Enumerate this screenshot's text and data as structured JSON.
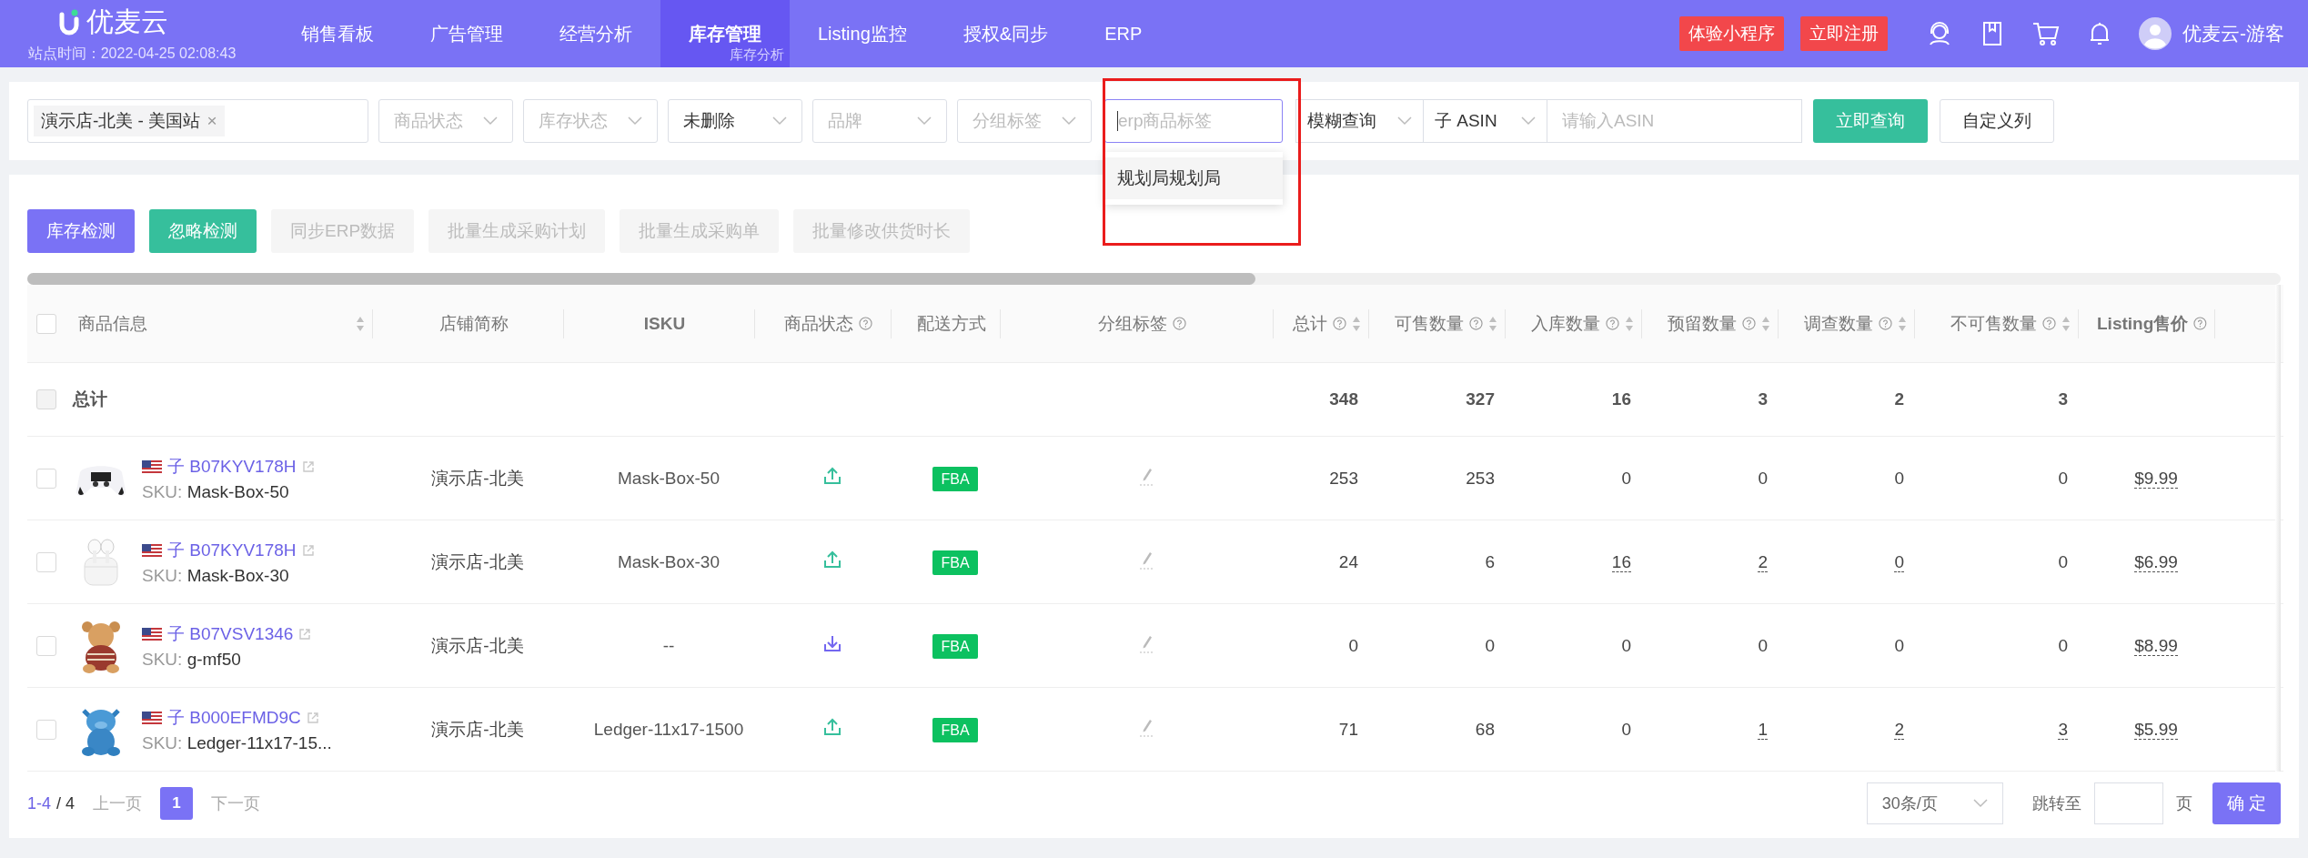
{
  "header": {
    "logo": "优麦云",
    "site_time": "站点时间：2022-04-25 02:08:43",
    "nav": [
      {
        "label": "销售看板",
        "selected": false
      },
      {
        "label": "广告管理",
        "selected": false
      },
      {
        "label": "经营分析",
        "selected": false
      },
      {
        "label": "库存管理",
        "selected": true,
        "sub": "库存分析"
      },
      {
        "label": "Listing监控",
        "selected": false
      },
      {
        "label": "授权&同步",
        "selected": false
      },
      {
        "label": "ERP",
        "selected": false
      }
    ],
    "promos": [
      "体验小程序",
      "立即注册"
    ],
    "user": "优麦云-游客"
  },
  "filters": {
    "store": {
      "tag": "演示店-北美 - 美国站",
      "close": "×"
    },
    "selects": [
      {
        "placeholder": "商品状态"
      },
      {
        "placeholder": "库存状态"
      },
      {
        "value": "未删除"
      },
      {
        "placeholder": "品牌"
      },
      {
        "placeholder": "分组标签"
      }
    ],
    "tag_input": {
      "placeholder": "erp商品标签",
      "focused": true,
      "options": [
        "规划局规划局"
      ]
    },
    "match": {
      "value": "模糊查询"
    },
    "type": {
      "value": "子 ASIN"
    },
    "asin": {
      "placeholder": "请输入ASIN"
    },
    "search_button": "立即查询",
    "columns_button": "自定义列"
  },
  "actions": [
    {
      "label": "库存检测",
      "kind": "primary"
    },
    {
      "label": "忽略检测",
      "kind": "success"
    },
    {
      "label": "同步ERP数据",
      "kind": "disabled"
    },
    {
      "label": "批量生成采购计划",
      "kind": "disabled"
    },
    {
      "label": "批量生成采购单",
      "kind": "disabled"
    },
    {
      "label": "批量修改供货时长",
      "kind": "disabled"
    }
  ],
  "table": {
    "header_checked": false,
    "columns": [
      {
        "label": "商品信息",
        "help": false,
        "sortable": true,
        "bold": false
      },
      {
        "label": "店铺简称",
        "help": false,
        "sortable": false,
        "bold": false
      },
      {
        "label": "ISKU",
        "help": false,
        "sortable": false,
        "bold": true
      },
      {
        "label": "商品状态",
        "help": true,
        "sortable": false,
        "bold": false
      },
      {
        "label": "配送方式",
        "help": false,
        "sortable": false,
        "bold": false
      },
      {
        "label": "分组标签",
        "help": true,
        "sortable": false,
        "bold": false
      },
      {
        "label": "总计",
        "help": true,
        "sortable": true,
        "bold": false
      },
      {
        "label": "可售数量",
        "help": true,
        "sortable": true,
        "bold": false
      },
      {
        "label": "入库数量",
        "help": true,
        "sortable": true,
        "bold": false
      },
      {
        "label": "预留数量",
        "help": true,
        "sortable": true,
        "bold": false
      },
      {
        "label": "调查数量",
        "help": true,
        "sortable": true,
        "bold": false
      },
      {
        "label": "不可售数量",
        "help": true,
        "sortable": true,
        "bold": false
      },
      {
        "label": "Listing售价",
        "help": true,
        "sortable": false,
        "bold": true
      }
    ],
    "total": {
      "label": "总计",
      "checked": false,
      "disabled": true,
      "values": [
        "348",
        "327",
        "16",
        "3",
        "2",
        "3"
      ]
    },
    "rows": [
      {
        "checked": false,
        "asin_prefix": "子",
        "asin": "B07KYV178H",
        "sku_label": "SKU:",
        "sku": "Mask-Box-50",
        "store": "演示店-北美",
        "isku": "Mask-Box-50",
        "kind": "upload",
        "fulfillment": "FBA",
        "values": [
          {
            "text": "253",
            "linked": false
          },
          {
            "text": "253",
            "linked": false
          },
          {
            "text": "0",
            "linked": false
          },
          {
            "text": "0",
            "linked": false
          },
          {
            "text": "0",
            "linked": false
          },
          {
            "text": "0",
            "linked": false
          }
        ],
        "price": "$9.99"
      },
      {
        "checked": false,
        "asin_prefix": "子",
        "asin": "B07KYV178H",
        "sku_label": "SKU:",
        "sku": "Mask-Box-30",
        "store": "演示店-北美",
        "isku": "Mask-Box-30",
        "kind": "upload",
        "fulfillment": "FBA",
        "values": [
          {
            "text": "24",
            "linked": false
          },
          {
            "text": "6",
            "linked": false
          },
          {
            "text": "16",
            "linked": true
          },
          {
            "text": "2",
            "linked": true
          },
          {
            "text": "0",
            "linked": true
          },
          {
            "text": "0",
            "linked": false
          }
        ],
        "price": "$6.99"
      },
      {
        "checked": false,
        "asin_prefix": "子",
        "asin": "B07VSV1346",
        "sku_label": "SKU:",
        "sku": "g-mf50",
        "store": "演示店-北美",
        "isku": "--",
        "kind": "download",
        "fulfillment": "FBA",
        "values": [
          {
            "text": "0",
            "linked": false
          },
          {
            "text": "0",
            "linked": false
          },
          {
            "text": "0",
            "linked": false
          },
          {
            "text": "0",
            "linked": false
          },
          {
            "text": "0",
            "linked": false
          },
          {
            "text": "0",
            "linked": false
          }
        ],
        "price": "$8.99"
      },
      {
        "checked": false,
        "asin_prefix": "子",
        "asin": "B000EFMD9C",
        "sku_label": "SKU:",
        "sku": "Ledger-11x17-15...",
        "store": "演示店-北美",
        "isku": "Ledger-11x17-1500",
        "kind": "upload",
        "fulfillment": "FBA",
        "values": [
          {
            "text": "71",
            "linked": false
          },
          {
            "text": "68",
            "linked": false
          },
          {
            "text": "0",
            "linked": false
          },
          {
            "text": "1",
            "linked": true
          },
          {
            "text": "2",
            "linked": true
          },
          {
            "text": "3",
            "linked": true
          }
        ],
        "price": "$5.99"
      }
    ]
  },
  "pagination": {
    "range": "1-4",
    "total": "/ 4",
    "prev": "上一页",
    "pages": [
      {
        "label": "1",
        "selected": true
      }
    ],
    "next": "下一页",
    "page_size": "30条/页",
    "jump_label": "跳转至",
    "jump_unit": "页",
    "confirm": "确 定"
  }
}
